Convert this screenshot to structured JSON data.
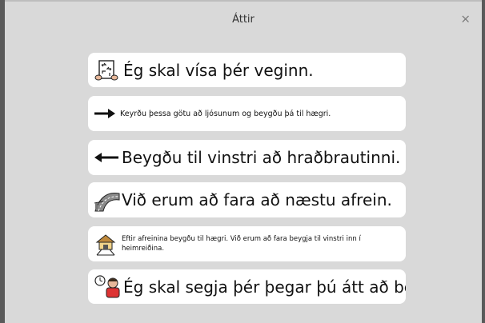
{
  "dialog": {
    "title": "Áttir",
    "close_label": "×"
  },
  "items": [
    {
      "text": "Ég skal vísa þér veginn.",
      "icon": "directions-map-icon"
    },
    {
      "text": "Keyrðu þessa götu að ljósunum og beygðu þá til hægri.",
      "icon": "arrow-right-icon"
    },
    {
      "text": "Beygðu til vinstri að hraðbrautinni.",
      "icon": "arrow-left-icon"
    },
    {
      "text": "Við erum að fara að næstu afrein.",
      "icon": "highway-exit-icon"
    },
    {
      "text": "Eftir afreinina beygðu til hægri. Við erum að fara beygja til vinstri inn í heimreiðina.",
      "icon": "driveway-icon"
    },
    {
      "text": "Ég skal segja þér þegar þú átt að beygja.",
      "icon": "person-clock-icon"
    }
  ]
}
